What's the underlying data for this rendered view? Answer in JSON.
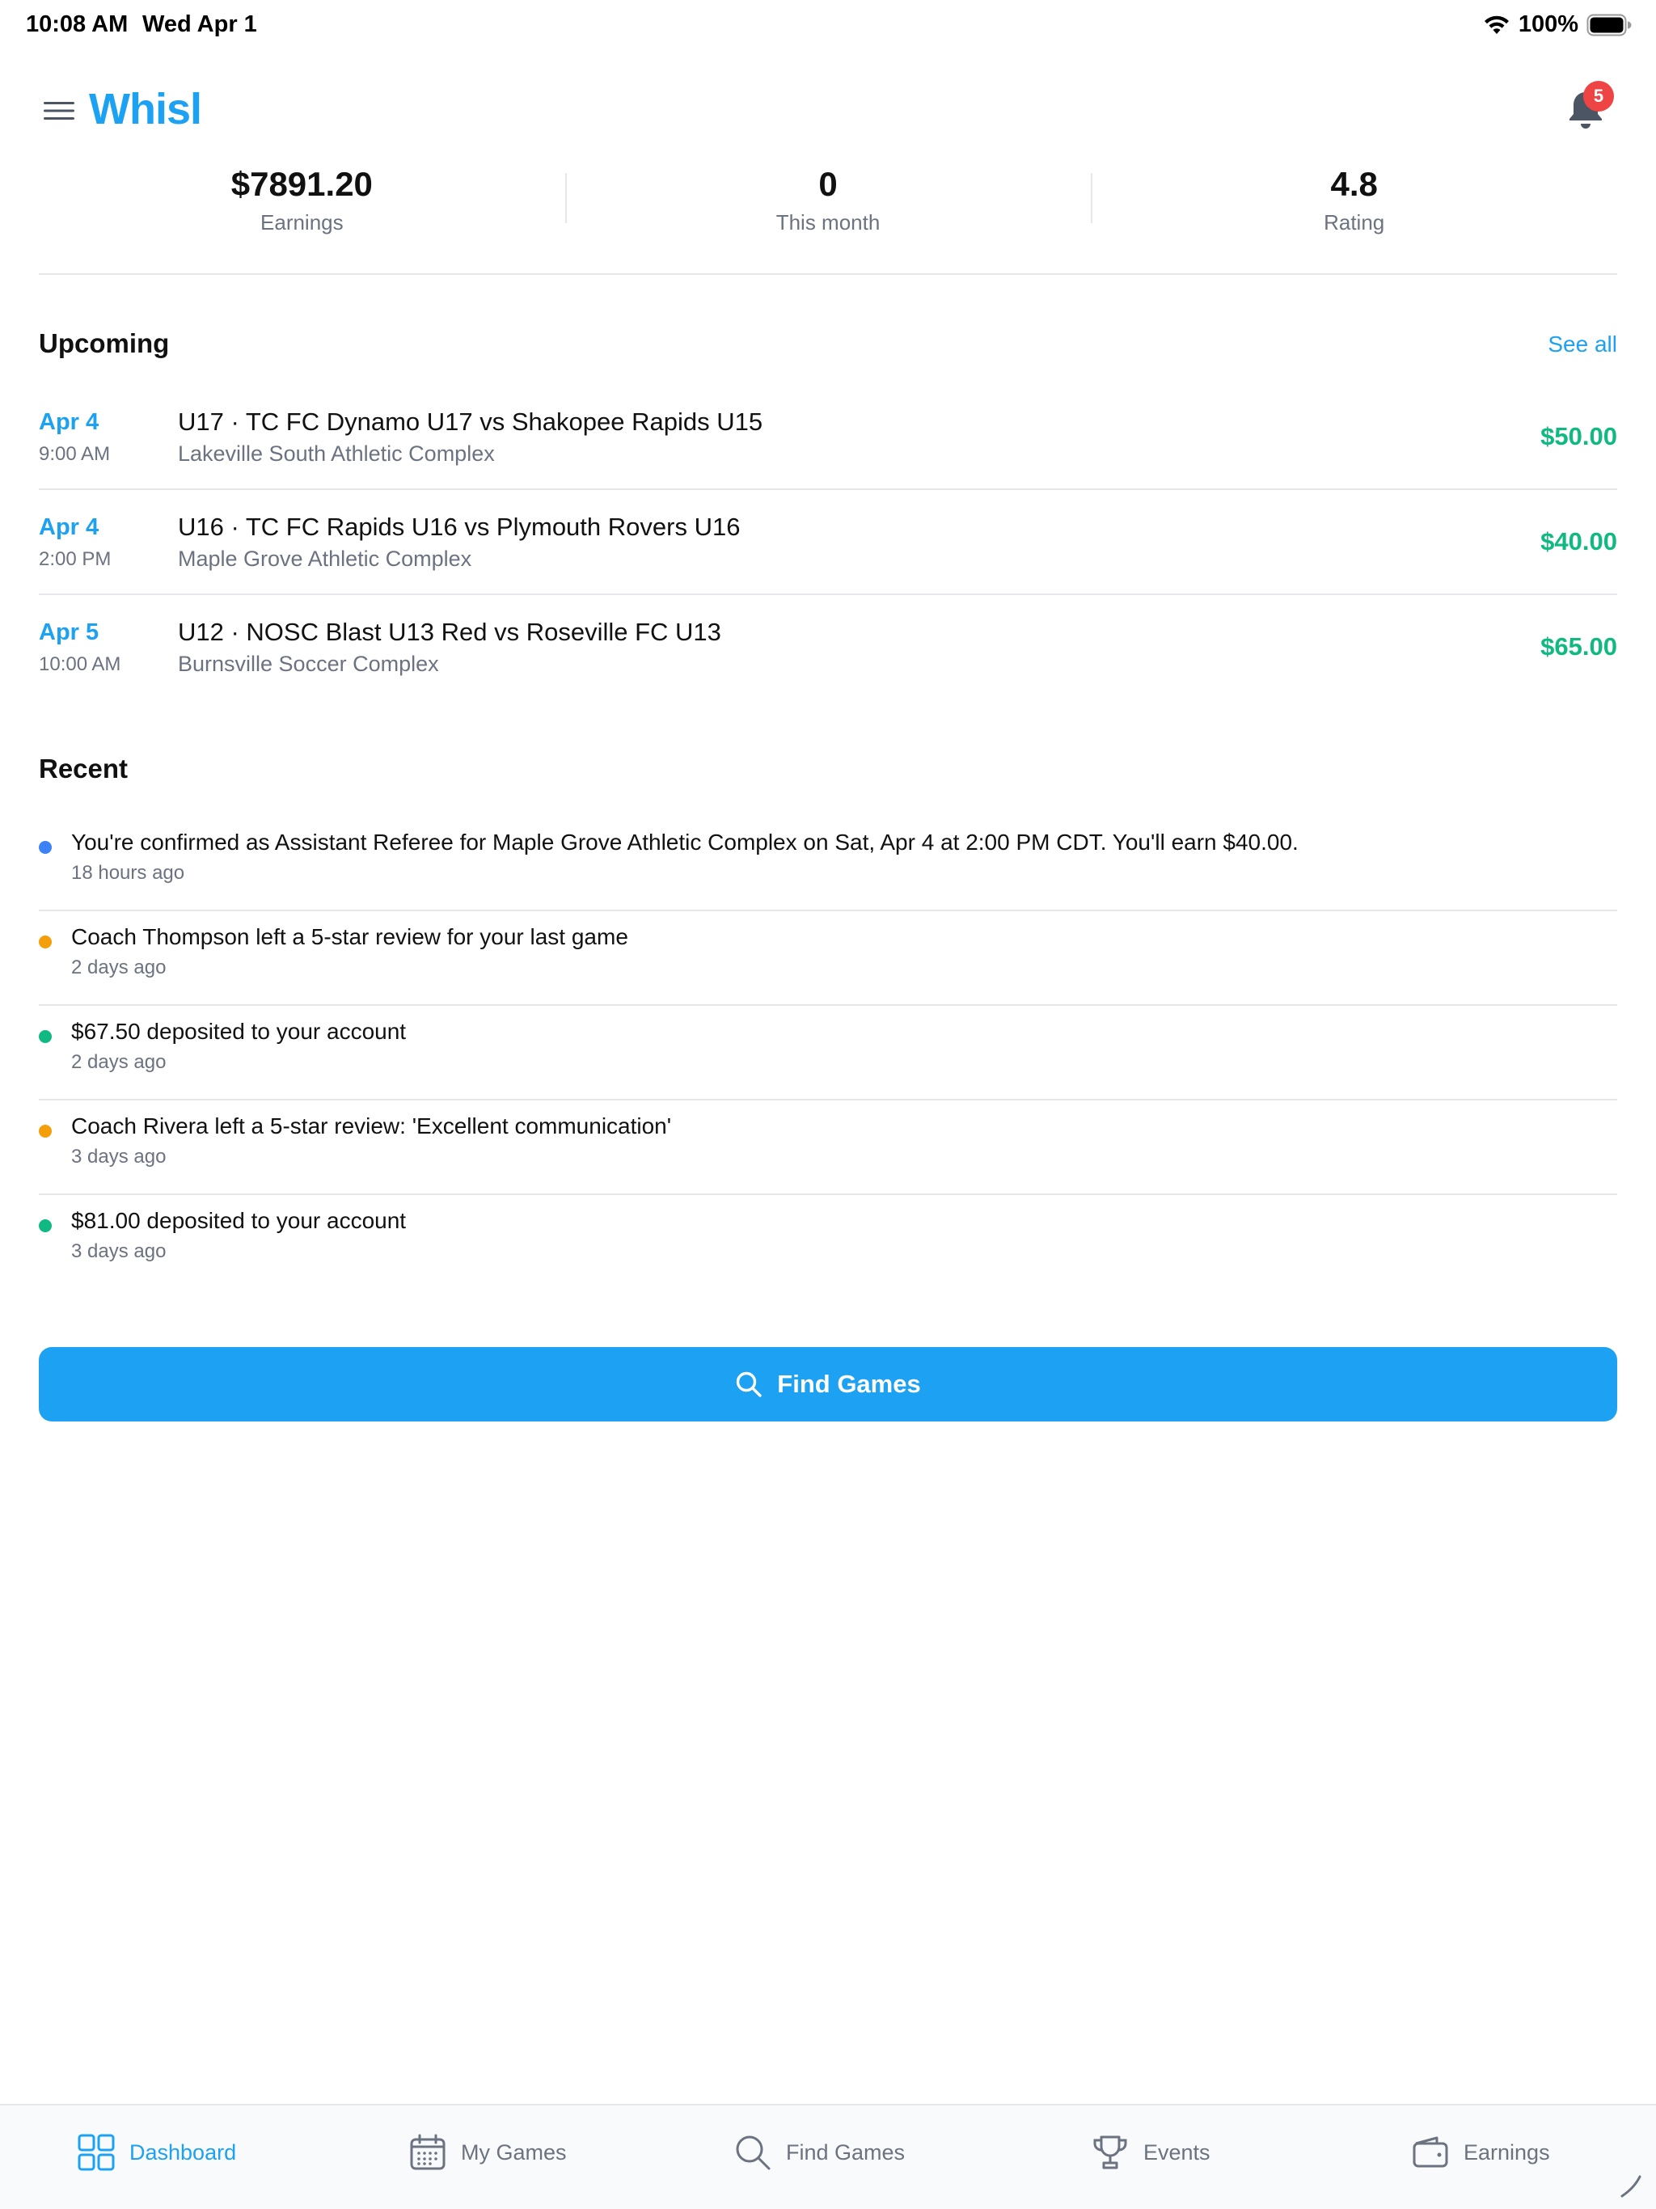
{
  "status_bar": {
    "time": "10:08 AM",
    "date": "Wed Apr 1",
    "battery": "100%"
  },
  "header": {
    "app_name": "Whisl",
    "notification_count": "5"
  },
  "stats": [
    {
      "value": "$7891.20",
      "label": "Earnings"
    },
    {
      "value": "0",
      "label": "This month"
    },
    {
      "value": "4.8",
      "label": "Rating"
    }
  ],
  "upcoming": {
    "title": "Upcoming",
    "see_all": "See all",
    "games": [
      {
        "date": "Apr 4",
        "time": "9:00 AM",
        "title": "U17 · TC FC Dynamo U17 vs Shakopee Rapids U15",
        "venue": "Lakeville South Athletic Complex",
        "pay": "$50.00"
      },
      {
        "date": "Apr 4",
        "time": "2:00 PM",
        "title": "U16 · TC FC Rapids U16 vs Plymouth Rovers U16",
        "venue": "Maple Grove Athletic Complex",
        "pay": "$40.00"
      },
      {
        "date": "Apr 5",
        "time": "10:00 AM",
        "title": "U12 · NOSC Blast U13 Red vs Roseville FC U13",
        "venue": "Burnsville Soccer Complex",
        "pay": "$65.00"
      }
    ]
  },
  "recent": {
    "title": "Recent",
    "items": [
      {
        "text": "You're confirmed as Assistant Referee for Maple Grove Athletic Complex on Sat, Apr 4 at 2:00 PM CDT. You'll earn $40.00.",
        "time": "18 hours ago",
        "color": "#3b82f6"
      },
      {
        "text": "Coach Thompson left a 5-star review for your last game",
        "time": "2 days ago",
        "color": "#f59e0b"
      },
      {
        "text": "$67.50 deposited to your account",
        "time": "2 days ago",
        "color": "#10b981"
      },
      {
        "text": "Coach Rivera left a 5-star review: 'Excellent communication'",
        "time": "3 days ago",
        "color": "#f59e0b"
      },
      {
        "text": "$81.00 deposited to your account",
        "time": "3 days ago",
        "color": "#10b981"
      }
    ]
  },
  "find_button": {
    "label": "Find Games"
  },
  "tabs": [
    {
      "label": "Dashboard",
      "icon": "grid-icon",
      "active": true
    },
    {
      "label": "My Games",
      "icon": "calendar-icon",
      "active": false
    },
    {
      "label": "Find Games",
      "icon": "search-icon",
      "active": false
    },
    {
      "label": "Events",
      "icon": "trophy-icon",
      "active": false
    },
    {
      "label": "Earnings",
      "icon": "wallet-icon",
      "active": false
    }
  ],
  "colors": {
    "accent": "#1da1f2",
    "money": "#10b981",
    "badge": "#ef4444"
  }
}
